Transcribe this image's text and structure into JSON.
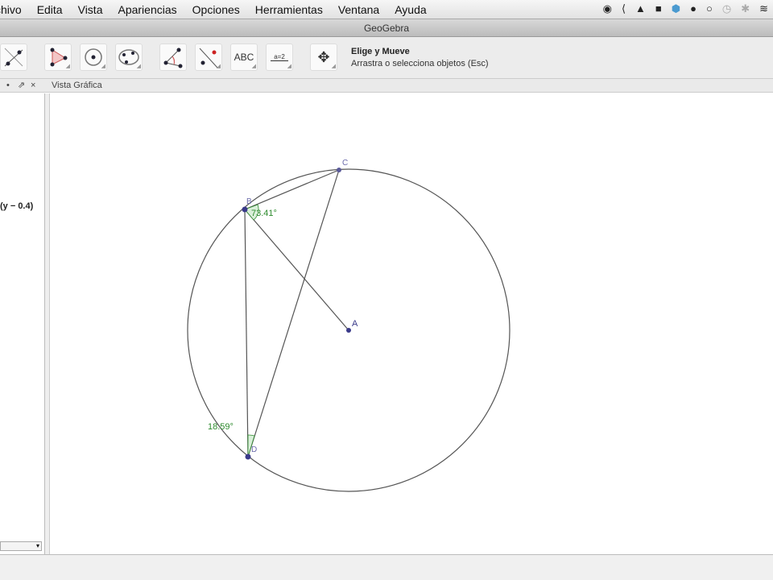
{
  "menu": [
    "chivo",
    "Edita",
    "Vista",
    "Apariencias",
    "Opciones",
    "Herramientas",
    "Ventana",
    "Ayuda"
  ],
  "window_title": "GeoGebra",
  "toolbar": {
    "tools": [
      "move-point",
      "point",
      "line",
      "triangle",
      "circle",
      "conic",
      "angle",
      "reflect",
      "text",
      "slider",
      "move-view"
    ],
    "text_label": "ABC",
    "slider_label": "a=2",
    "active_tool_name": "Elige y Mueve",
    "active_tool_help": "Arrastra o selecciona objetos (Esc)"
  },
  "view_header": {
    "title": "Vista Gráfica"
  },
  "algebra": {
    "item": "(y − 0.4)"
  },
  "construction": {
    "points": [
      {
        "name": "A",
        "x": 0,
        "y": 0
      },
      {
        "name": "B",
        "x": -0.645,
        "y": 0.75
      },
      {
        "name": "C",
        "x": -0.06,
        "y": 1.0
      },
      {
        "name": "D",
        "x": -0.625,
        "y": -0.785
      }
    ],
    "angles": [
      {
        "label": "73.41°",
        "vertex": "B"
      },
      {
        "label": "18.59°",
        "vertex": "D"
      }
    ],
    "colors": {
      "point": "#3a3a8a",
      "angle": "#2e8b2e",
      "line": "#555555"
    }
  }
}
